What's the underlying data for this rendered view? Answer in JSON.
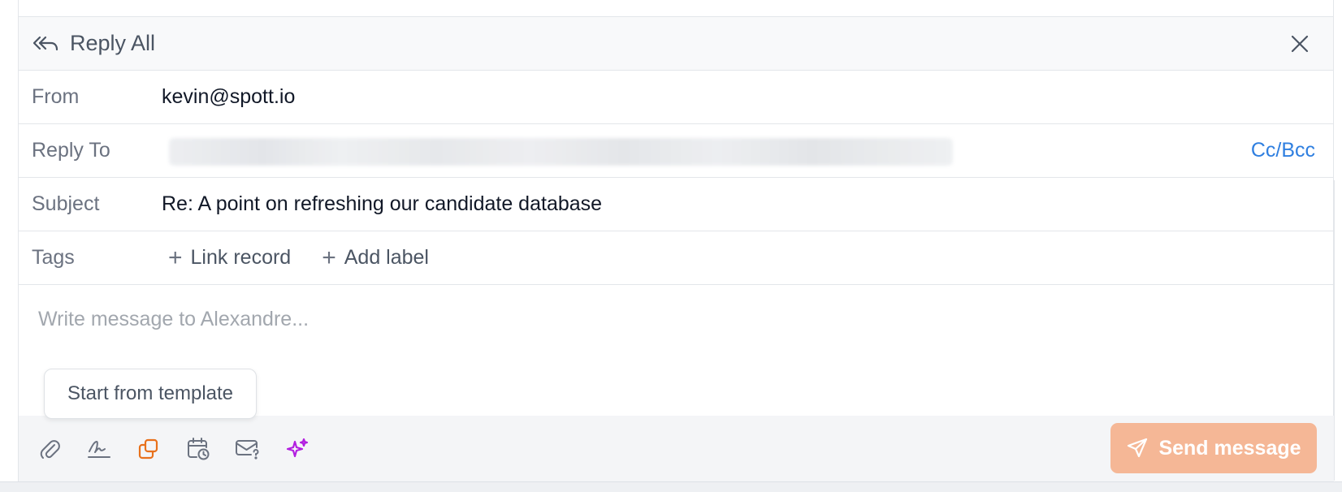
{
  "header": {
    "title": "Reply All",
    "close_icon": "close-icon",
    "reply_icon": "reply-all-icon"
  },
  "fields": {
    "from": {
      "label": "From",
      "value": "kevin@spott.io"
    },
    "reply_to": {
      "label": "Reply To",
      "value": "",
      "cc_bcc_label": "Cc/Bcc"
    },
    "subject": {
      "label": "Subject",
      "value": "Re: A point on refreshing our candidate database"
    },
    "tags": {
      "label": "Tags",
      "link_record": "Link record",
      "add_label": "Add label"
    }
  },
  "body": {
    "placeholder": "Write message to Alexandre...",
    "template_button": "Start from template"
  },
  "toolbar": {
    "icons": [
      "paperclip-icon",
      "signature-icon",
      "templates-icon",
      "schedule-send-icon",
      "email-question-icon",
      "ai-sparkle-icon"
    ],
    "send_label": "Send message"
  },
  "colors": {
    "accent_link": "#2f7fe0",
    "send_button": "#f5b796",
    "templates_icon": "#e8711c",
    "ai_icon": "#b21ee0"
  }
}
